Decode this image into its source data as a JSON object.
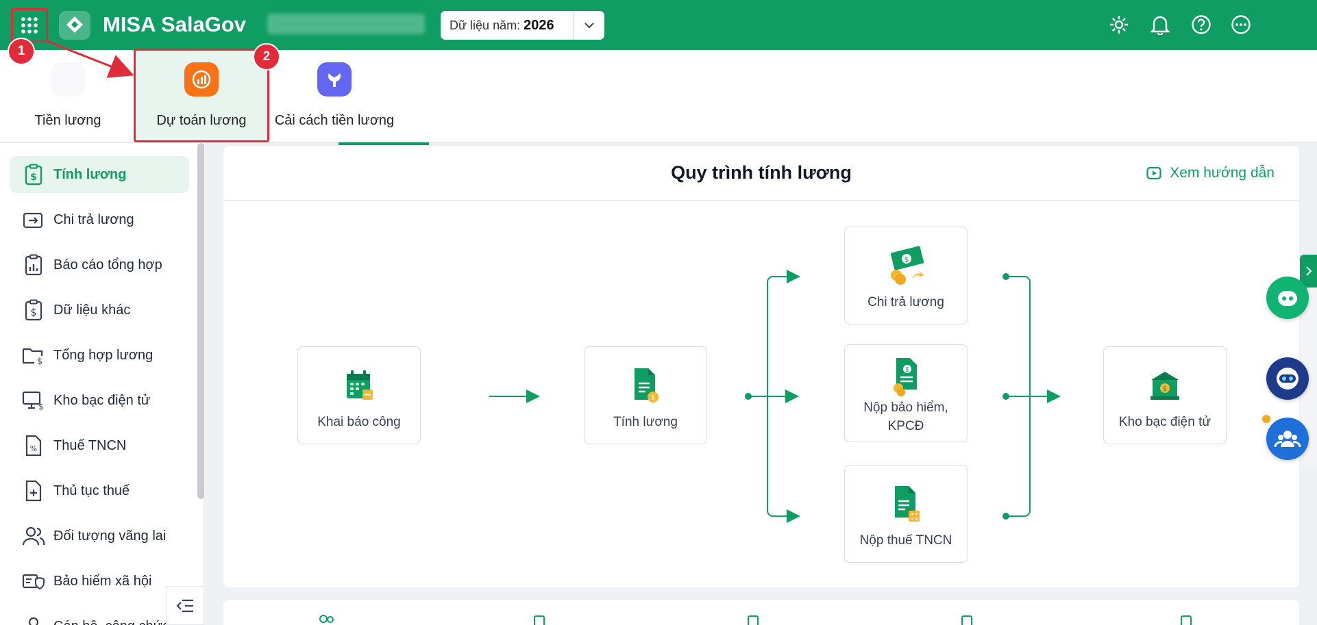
{
  "header": {
    "app_name": "MISA SalaGov",
    "year_label": "Dữ liệu năm:",
    "year_value": "2026",
    "icons": [
      "grid-icon",
      "settings-icon",
      "bell-icon",
      "help-icon",
      "more-icon"
    ]
  },
  "apps": [
    {
      "label": "Tiền lương",
      "icon": "salary-app-icon"
    },
    {
      "label": "Dự toán lương",
      "icon": "budget-chart-icon",
      "selected": true
    },
    {
      "label": "Cải cách tiền lương",
      "icon": "wrench-icon"
    }
  ],
  "annotations": {
    "step1": "1",
    "step2": "2"
  },
  "sidebar": {
    "items": [
      {
        "label": "Tính lương",
        "icon": "clipboard-dollar-icon",
        "active": true
      },
      {
        "label": "Chi trả lương",
        "icon": "wallet-transfer-icon"
      },
      {
        "label": "Báo cáo tổng hợp",
        "icon": "report-icon"
      },
      {
        "label": "Dữ liệu khác",
        "icon": "clipboard-dollar-icon"
      },
      {
        "label": "Tổng hợp lương",
        "icon": "folder-dollar-icon"
      },
      {
        "label": "Kho bạc điện tử",
        "icon": "monitor-dollar-icon"
      },
      {
        "label": "Thuế TNCN",
        "icon": "tax-file-icon"
      },
      {
        "label": "Thủ tục thuế",
        "icon": "file-plus-icon"
      },
      {
        "label": "Đối tượng vãng lai",
        "icon": "users-icon"
      },
      {
        "label": "Bảo hiểm xã hội",
        "icon": "insurance-icon"
      },
      {
        "label": "Cán bộ, công chức",
        "icon": "person-icon"
      }
    ]
  },
  "main": {
    "title": "Quy trình tính lương",
    "guide_label": "Xem hướng dẫn",
    "nodes": {
      "khai_bao": "Khai báo công",
      "tinh_luong": "Tính lương",
      "chi_tra": "Chi trả lương",
      "nop_bh": "Nộp bảo hiểm,\nKPCĐ",
      "nop_thue": "Nộp thuế TNCN",
      "kho_bac": "Kho bạc điện tử"
    }
  },
  "colors": {
    "brand": "#0f9d63",
    "annotation": "#e02b3a",
    "orange": "#f97316",
    "indigo": "#6366f1"
  }
}
